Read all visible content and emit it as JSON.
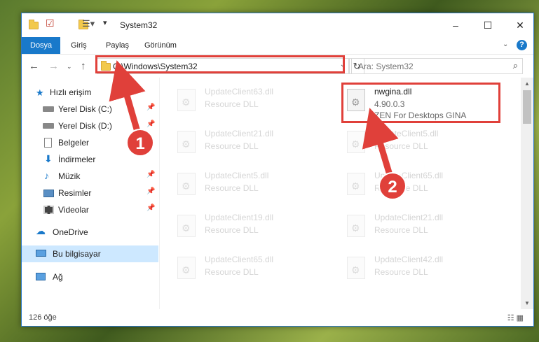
{
  "window": {
    "title": "System32"
  },
  "ribbon": {
    "tabs": [
      "Dosya",
      "Giriş",
      "Paylaş",
      "Görünüm"
    ]
  },
  "address": {
    "path": "C:\\Windows\\System32",
    "search_placeholder": "Ara: System32"
  },
  "sidebar": {
    "items": [
      {
        "label": "Hızlı erişim"
      },
      {
        "label": "Yerel Disk (C:)"
      },
      {
        "label": "Yerel Disk (D:)"
      },
      {
        "label": "Belgeler"
      },
      {
        "label": "İndirmeler"
      },
      {
        "label": "Müzik"
      },
      {
        "label": "Resimler"
      },
      {
        "label": "Videolar"
      },
      {
        "label": "OneDrive"
      },
      {
        "label": "Bu bilgisayar"
      },
      {
        "label": "Ağ"
      }
    ]
  },
  "files": {
    "highlighted": {
      "name": "nwgina.dll",
      "version": "4.90.0.3",
      "description": "ZEN For Desktops GINA"
    },
    "left": [
      {
        "name": "UpdateClient63.dll",
        "type": "Resource DLL"
      },
      {
        "name": "UpdateClient21.dll",
        "type": "Resource DLL"
      },
      {
        "name": "UpdateClient5.dll",
        "type": "Resource DLL"
      },
      {
        "name": "UpdateClient19.dll",
        "type": "Resource DLL"
      },
      {
        "name": "UpdateClient65.dll",
        "type": "Resource DLL"
      }
    ],
    "right": [
      {
        "name": "UpdateClient5.dll",
        "type": "Resource DLL"
      },
      {
        "name": "UpdateClient65.dll",
        "type": "Resource DLL"
      },
      {
        "name": "UpdateClient21.dll",
        "type": "Resource DLL"
      },
      {
        "name": "UpdateClient42.dll",
        "type": "Resource DLL"
      }
    ]
  },
  "status": {
    "count": "126 öğe"
  },
  "annotations": {
    "step1": "1",
    "step2": "2",
    "color": "#e0403a"
  }
}
